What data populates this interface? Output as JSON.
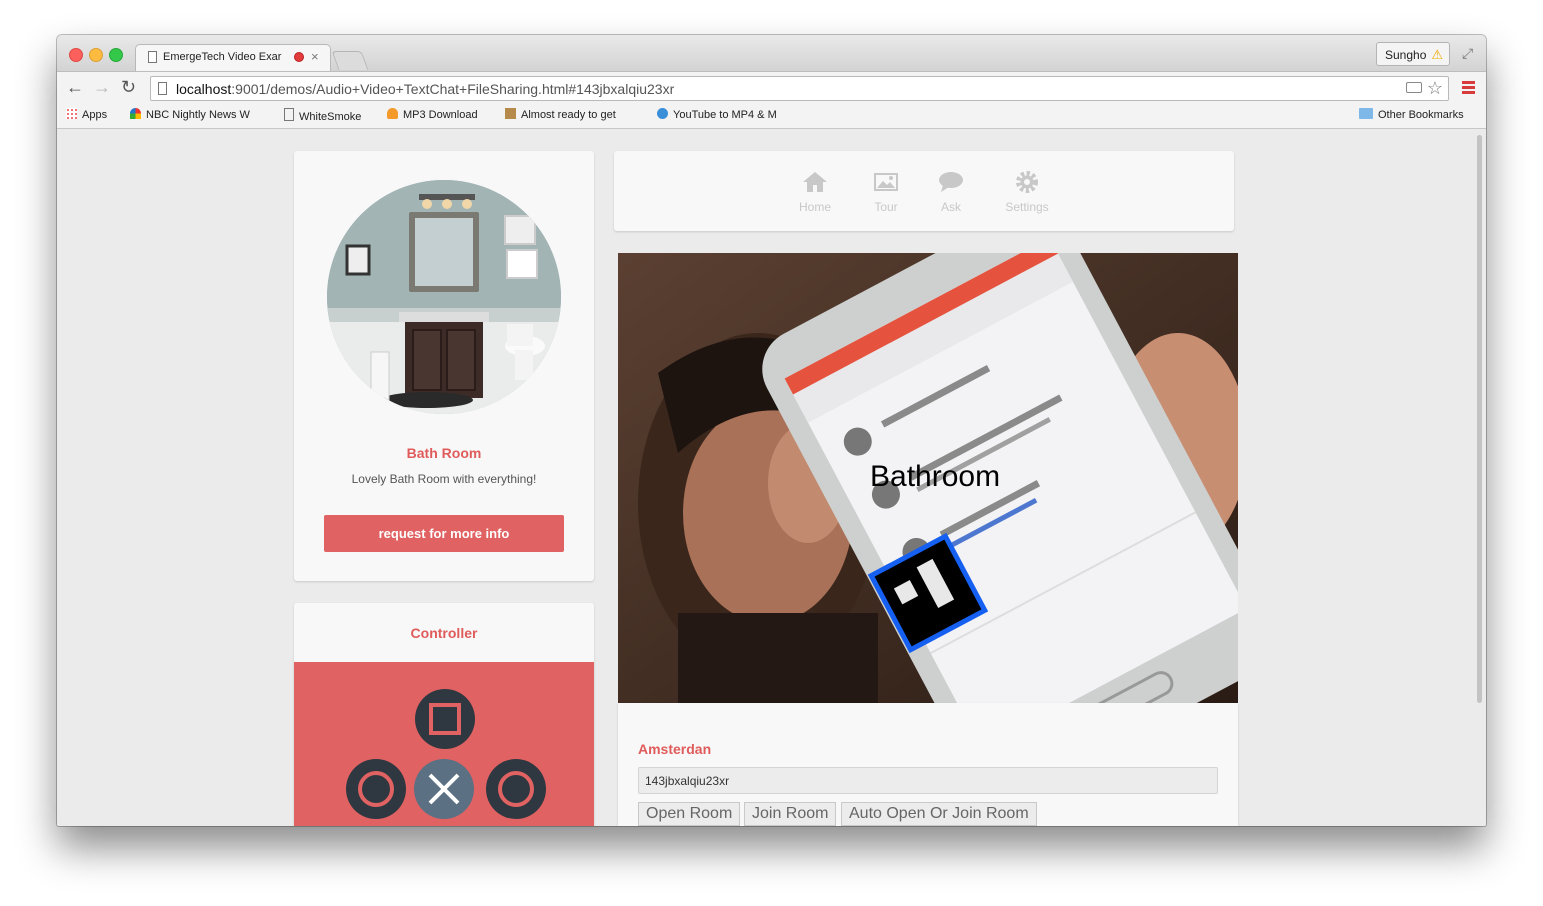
{
  "browser": {
    "tab_title": "EmergeTech Video Exar",
    "url_host": "localhost",
    "url_rest": ":9001/demos/Audio+Video+TextChat+FileSharing.html#143jbxalqiu23xr",
    "profile_name": "Sungho",
    "bookmarks": [
      "Apps",
      "NBC Nightly News W",
      "WhiteSmoke",
      "MP3 Download",
      "Almost ready to get",
      "YouTube to MP4 & M"
    ],
    "other_bookmarks": "Other Bookmarks"
  },
  "nav": {
    "items": [
      "Home",
      "Tour",
      "Ask",
      "Settings"
    ]
  },
  "profile": {
    "room_name": "Bath Room",
    "description": "Lovely Bath Room with everything!",
    "request_button": "request for more info"
  },
  "controller": {
    "title": "Controller"
  },
  "video": {
    "marker_label": "Bathroom"
  },
  "room": {
    "heading": "Amsterdan",
    "room_id_value": "143jbxalqiu23xr",
    "buttons": [
      "Open Room",
      "Join Room",
      "Auto Open Or Join Room"
    ]
  },
  "colors": {
    "accent": "#e06262",
    "nav_icon": "#c8c8c8",
    "marker_outline": "#1560f0"
  }
}
